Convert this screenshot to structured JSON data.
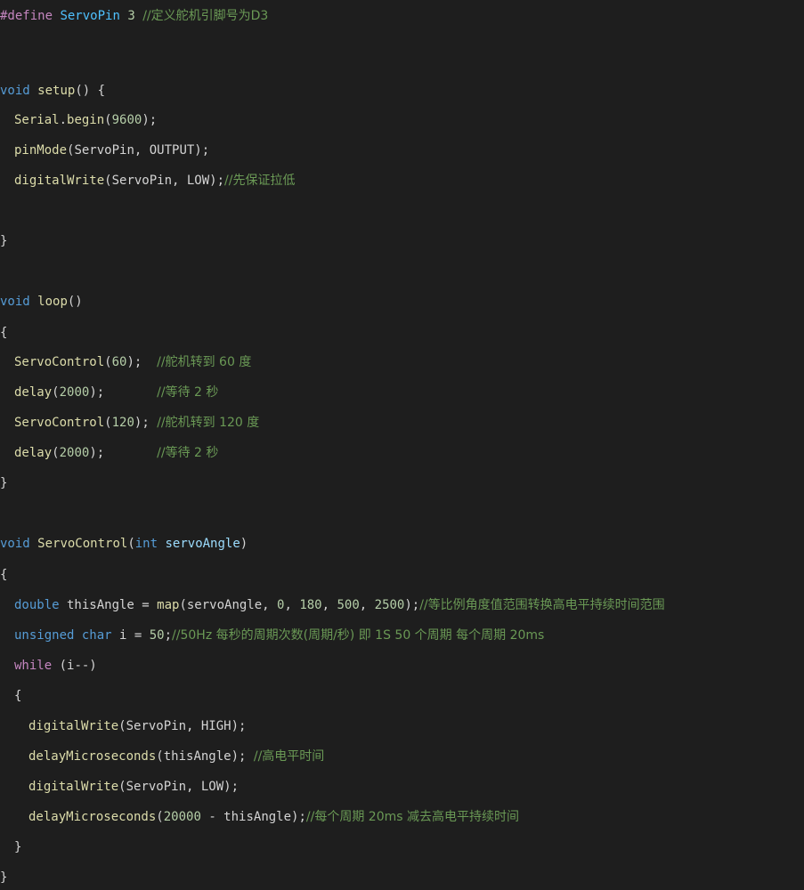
{
  "code": {
    "l1": {
      "directive": "#define",
      "macro": "ServoPin",
      "value": "3",
      "comment": "//定义舵机引脚号为D3"
    },
    "setup": {
      "type": "void",
      "name": "setup",
      "paren": "() {"
    },
    "serial": {
      "obj": "Serial",
      "dot": ".",
      "fn": "begin",
      "open": "(",
      "num": "9600",
      "close": ");"
    },
    "pinmode": {
      "fn": "pinMode",
      "args": "(ServoPin, OUTPUT);"
    },
    "dw_low": {
      "fn": "digitalWrite",
      "args": "(ServoPin, LOW);",
      "comment": "//先保证拉低"
    },
    "close_brace_1": "}",
    "loop": {
      "type": "void",
      "name": "loop",
      "paren": "()"
    },
    "open_brace_2": "{",
    "sc60": {
      "fn": "ServoControl",
      "open": "(",
      "num": "60",
      "close": ");  ",
      "comment": "//舵机转到 60 度"
    },
    "delay1": {
      "fn": "delay",
      "open": "(",
      "num": "2000",
      "close": ");       ",
      "comment": "//等待 2 秒"
    },
    "sc120": {
      "fn": "ServoControl",
      "open": "(",
      "num": "120",
      "close": "); ",
      "comment": "//舵机转到 120 度"
    },
    "delay2": {
      "fn": "delay",
      "open": "(",
      "num": "2000",
      "close": ");       ",
      "comment": "//等待 2 秒"
    },
    "close_brace_2": "}",
    "sc_def": {
      "type": "void",
      "name": "ServoControl",
      "open": "(",
      "ptype": "int",
      "sp": " ",
      "param": "servoAngle",
      "close": ")"
    },
    "open_brace_3": "{",
    "dbl": {
      "type": "double",
      "rest1": " thisAngle = ",
      "fn": "map",
      "rest2": "(servoAngle, ",
      "n1": "0",
      "c1": ", ",
      "n2": "180",
      "c2": ", ",
      "n3": "500",
      "c3": ", ",
      "n4": "2500",
      "end": ");",
      "comment": "//等比例角度值范围转换高电平持续时间范围"
    },
    "uchar": {
      "type1": "unsigned",
      "sp": " ",
      "type2": "char",
      "rest": " i = ",
      "num": "50",
      "end": ";",
      "comment": "//50Hz 每秒的周期次数(周期/秒) 即 1S 50 个周期 每个周期 20ms"
    },
    "while": {
      "kw": "while",
      "rest": " (i--)"
    },
    "open_brace_4": "{",
    "dw_high": {
      "fn": "digitalWrite",
      "args": "(ServoPin, HIGH);"
    },
    "dmicro1": {
      "fn": "delayMicroseconds",
      "args": "(thisAngle); ",
      "comment": "//高电平时间"
    },
    "dw_low2": {
      "fn": "digitalWrite",
      "args": "(ServoPin, LOW);"
    },
    "dmicro2": {
      "fn": "delayMicroseconds",
      "open": "(",
      "num": "20000",
      "rest": " - thisAngle);",
      "comment": "//每个周期 20ms 减去高电平持续时间"
    },
    "close_brace_4": "}",
    "close_brace_3": "}"
  }
}
